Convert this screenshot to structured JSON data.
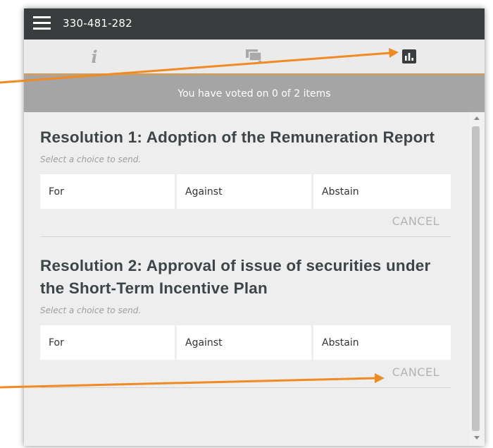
{
  "topbar": {
    "meeting_id": "330-481-282",
    "menu_icon": "hamburger-menu-icon"
  },
  "tabs": [
    {
      "name": "info",
      "icon": "info-icon",
      "glyph": "i"
    },
    {
      "name": "chat",
      "icon": "chat-icon"
    },
    {
      "name": "vote",
      "icon": "bar-chart-icon",
      "selected": true
    }
  ],
  "status": {
    "text": "You have voted on 0 of 2 items"
  },
  "resolutions": [
    {
      "title": "Resolution 1: Adoption of the Remuneration Report",
      "hint": "Select a choice to send.",
      "choices": [
        "For",
        "Against",
        "Abstain"
      ],
      "cancel_label": "CANCEL"
    },
    {
      "title": "Resolution 2: Approval of issue of securities under the Short-Term Incentive Plan",
      "hint": "Select a choice to send.",
      "choices": [
        "For",
        "Against",
        "Abstain"
      ],
      "cancel_label": "CANCEL"
    }
  ],
  "colors": {
    "topbar": "#3a3d3e",
    "tab_active_border": "#c9a06a",
    "status_bar": "#a5a5a5",
    "annotation_arrow": "#f08a24",
    "title_text": "#3d4548"
  }
}
